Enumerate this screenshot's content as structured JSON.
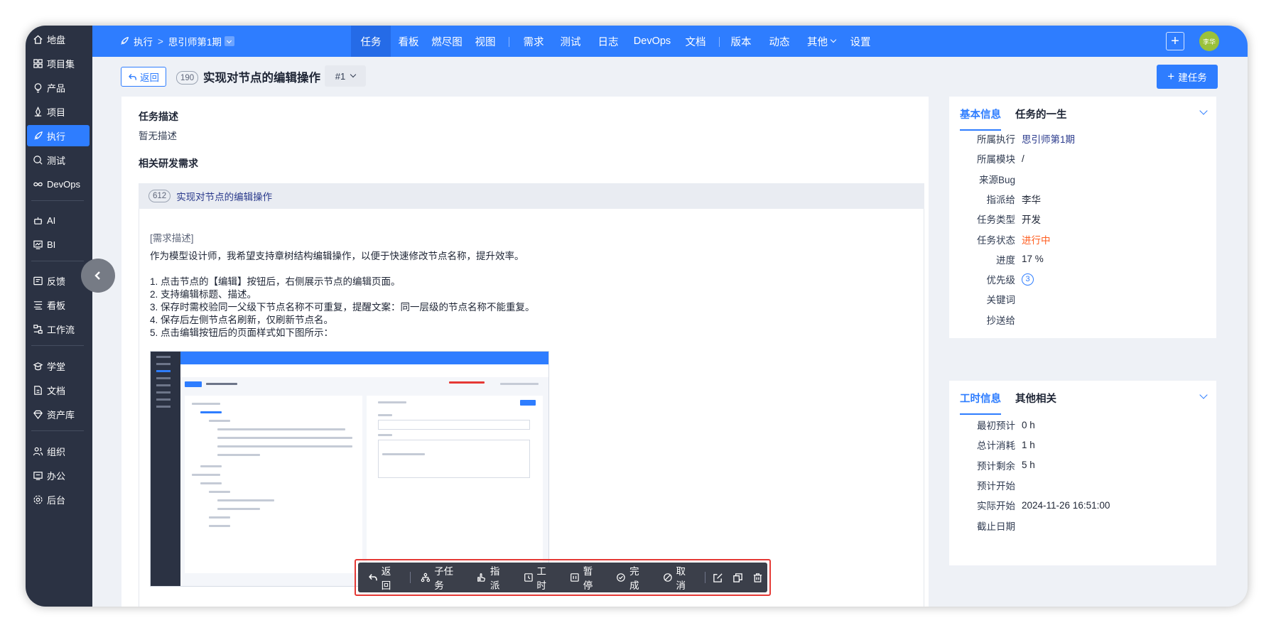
{
  "sidebar": {
    "items": [
      {
        "label": "地盘",
        "icon": "home-icon"
      },
      {
        "label": "项目集",
        "icon": "grid-icon"
      },
      {
        "label": "产品",
        "icon": "bulb-icon"
      },
      {
        "label": "项目",
        "icon": "project-icon"
      },
      {
        "label": "执行",
        "icon": "rocket-icon",
        "active": true
      },
      {
        "label": "测试",
        "icon": "test-icon"
      },
      {
        "label": "DevOps",
        "icon": "infinity-icon"
      },
      {
        "label": "AI",
        "icon": "robot-icon"
      },
      {
        "label": "BI",
        "icon": "chart-icon"
      },
      {
        "label": "反馈",
        "icon": "feedback-icon"
      },
      {
        "label": "看板",
        "icon": "kanban-icon"
      },
      {
        "label": "工作流",
        "icon": "workflow-icon"
      },
      {
        "label": "学堂",
        "icon": "school-icon"
      },
      {
        "label": "文档",
        "icon": "doc-icon"
      },
      {
        "label": "资产库",
        "icon": "diamond-icon"
      },
      {
        "label": "组织",
        "icon": "org-icon"
      },
      {
        "label": "办公",
        "icon": "office-icon"
      },
      {
        "label": "后台",
        "icon": "settings-icon"
      }
    ]
  },
  "topnav": {
    "breadcrumb": {
      "root": "执行",
      "separator": ">",
      "current": "思引师第1期"
    },
    "tabs": [
      {
        "label": "任务",
        "active": true
      },
      {
        "label": "看板"
      },
      {
        "label": "燃尽图"
      },
      {
        "label": "视图"
      },
      {
        "label": "需求"
      },
      {
        "label": "测试"
      },
      {
        "label": "日志"
      },
      {
        "label": "DevOps"
      },
      {
        "label": "文档"
      },
      {
        "label": "版本"
      },
      {
        "label": "动态"
      },
      {
        "label": "其他"
      },
      {
        "label": "设置"
      }
    ],
    "add_label": "+",
    "avatar_text": "李华"
  },
  "header": {
    "back_label": "返回",
    "task_id": "190",
    "title": "实现对节点的编辑操作",
    "version": "#1",
    "create_label": "建任务"
  },
  "task": {
    "desc_title": "任务描述",
    "desc_text": "暂无描述",
    "related_title": "相关研发需求",
    "story": {
      "id": "612",
      "title": "实现对节点的编辑操作",
      "desc_label": "[需求描述]",
      "lines": [
        "作为模型设计师，我希望支持章树结构编辑操作，以便于快速修改节点名称，提升效率。",
        "1. 点击节点的【编辑】按钮后，右侧展示节点的编辑页面。",
        "2. 支持编辑标题、描述。",
        "3. 保存时需校验同一父级下节点名称不可重复，提醒文案：同一层级的节点名称不能重复。",
        "4. 保存后左侧节点名刷新，仅刷新节点名。",
        "5. 点击编辑按钮后的页面样式如下图所示："
      ]
    }
  },
  "toolbar": {
    "back": "返回",
    "subtask": "子任务",
    "assign": "指派",
    "effort": "工时",
    "pause": "暂停",
    "finish": "完成",
    "cancel": "取消"
  },
  "basic_panel": {
    "tab_active": "基本信息",
    "tab_other": "任务的一生",
    "rows": [
      {
        "label": "所属执行",
        "value": "思引师第1期",
        "style": "link"
      },
      {
        "label": "所属模块",
        "value": "/",
        "style": ""
      },
      {
        "label": "来源Bug",
        "value": "",
        "style": ""
      },
      {
        "label": "指派给",
        "value": "李华",
        "style": ""
      },
      {
        "label": "任务类型",
        "value": "开发",
        "style": ""
      },
      {
        "label": "任务状态",
        "value": "进行中",
        "style": "red"
      },
      {
        "label": "进度",
        "value": "17 %",
        "style": ""
      },
      {
        "label": "优先级",
        "value": "3",
        "style": "prio"
      },
      {
        "label": "关键词",
        "value": "",
        "style": ""
      },
      {
        "label": "抄送给",
        "value": "",
        "style": ""
      }
    ]
  },
  "effort_panel": {
    "tab_active": "工时信息",
    "tab_other": "其他相关",
    "rows": [
      {
        "label": "最初预计",
        "value": "0 h"
      },
      {
        "label": "总计消耗",
        "value": "1 h"
      },
      {
        "label": "预计剩余",
        "value": "5 h"
      },
      {
        "label": "预计开始",
        "value": ""
      },
      {
        "label": "实际开始",
        "value": "2024-11-26 16:51:00"
      },
      {
        "label": "截止日期",
        "value": ""
      }
    ]
  },
  "colors": {
    "primary": "#2e7dff",
    "sidebar": "#2b3243",
    "status_in_progress": "#ff5d1f"
  }
}
